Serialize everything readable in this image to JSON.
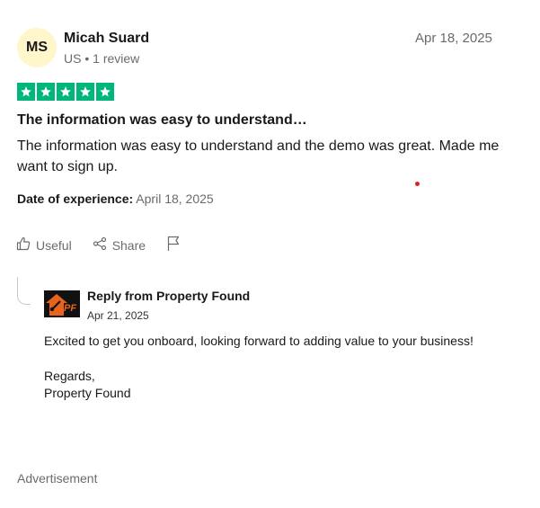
{
  "review": {
    "avatar_initials": "MS",
    "reviewer_name": "Micah Suard",
    "country": "US",
    "review_count": "1 review",
    "date": "Apr 18, 2025",
    "rating": 5,
    "title": "The information was easy to understand…",
    "body": "The information was easy to understand and the demo was great. Made me want to sign up.",
    "experience_label": "Date of experience:",
    "experience_date": "April 18, 2025"
  },
  "actions": {
    "useful_label": "Useful",
    "share_label": "Share",
    "report_icon": "flag-icon"
  },
  "reply": {
    "heading": "Reply from Property Found",
    "date": "Apr 21, 2025",
    "message": "Excited to get you onboard, looking forward to adding value to your business!",
    "signoff_line1": "Regards,",
    "signoff_line2": "Property Found",
    "logo_text": "PF"
  },
  "footer": {
    "advertisement_label": "Advertisement"
  },
  "colors": {
    "star_green": "#00b67a",
    "avatar_bg": "#fff6cc",
    "logo_orange": "#e8641e"
  }
}
